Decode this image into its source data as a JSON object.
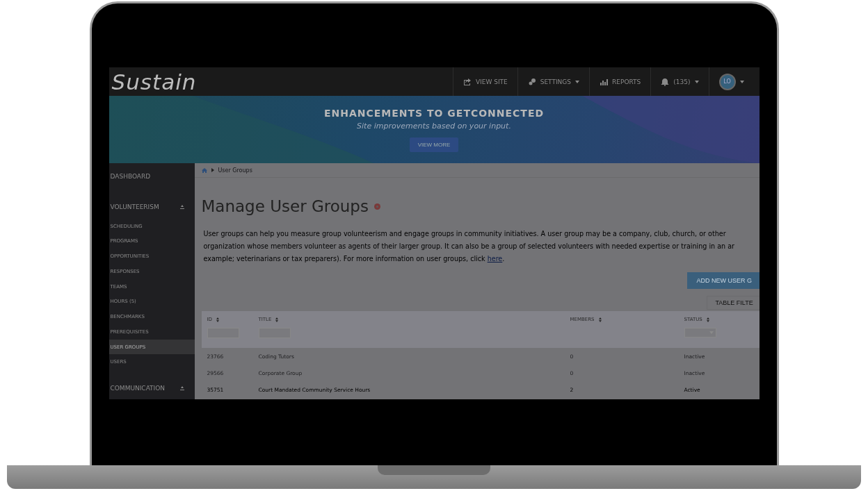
{
  "header": {
    "logo": "Sustain",
    "nav": [
      {
        "kind": "link",
        "label": "VIEW SITE"
      },
      {
        "kind": "menu",
        "label": "SETTINGS"
      },
      {
        "kind": "link",
        "label": "REPORTS"
      },
      {
        "kind": "menu",
        "label": "(135)"
      }
    ],
    "avatar": "LO"
  },
  "banner": {
    "title": "ENHANCEMENTS TO GETCONNECTED",
    "subtitle": "Site improvements based on your input.",
    "button": "VIEW MORE"
  },
  "sidebar": {
    "items": [
      {
        "kind": "top",
        "label": "DASHBOARD",
        "selected": false
      },
      {
        "kind": "section",
        "label": "VOLUNTEERISM",
        "selected": false
      },
      {
        "kind": "sub",
        "label": "SCHEDULING",
        "selected": false
      },
      {
        "kind": "sub",
        "label": "PROGRAMS",
        "selected": false
      },
      {
        "kind": "sub",
        "label": "OPPORTUNITIES",
        "selected": false
      },
      {
        "kind": "sub",
        "label": "RESPONSES",
        "selected": false
      },
      {
        "kind": "sub",
        "label": "TEAMS",
        "selected": false
      },
      {
        "kind": "sub",
        "label": "HOURS (5)",
        "selected": false
      },
      {
        "kind": "sub",
        "label": "BENCHMARKS",
        "selected": false
      },
      {
        "kind": "sub",
        "label": "PREREQUISITES",
        "selected": false
      },
      {
        "kind": "sub",
        "label": "USER GROUPS",
        "selected": true
      },
      {
        "kind": "sub",
        "label": "USERS",
        "selected": false
      },
      {
        "kind": "section",
        "label": "COMMUNICATION",
        "selected": false
      }
    ]
  },
  "breadcrumb": [
    "User Groups"
  ],
  "page": {
    "title": "Manage User Groups",
    "description_lines": [
      "User groups can help you measure group volunteerism and engage groups in community initiatives. A user group may be a company, club, church, or other",
      "organization whose members volunteer as agents of their larger group. It can also be a group of selected volunteers with needed expertise or training in an ar",
      "example; veterinarians or tax preparers). For more information on user groups, click"
    ],
    "link": "here",
    "link_after": ".",
    "add_button": "ADD NEW USER G",
    "filter_button": "TABLE FILTE"
  },
  "table": {
    "columns": [
      {
        "label": "ID"
      },
      {
        "label": "TITLE"
      },
      {
        "label": "MEMBERS"
      },
      {
        "label": "STATUS"
      }
    ],
    "rows": [
      {
        "cells": [
          "23766",
          "Coding Tutors",
          "0",
          "Inactive"
        ],
        "active": false
      },
      {
        "cells": [
          "29566",
          "Corporate Group",
          "0",
          "Inactive"
        ],
        "active": false
      },
      {
        "cells": [
          "35751",
          "Court Mandated Community Service Hours",
          "2",
          "Active"
        ],
        "active": true
      }
    ]
  }
}
